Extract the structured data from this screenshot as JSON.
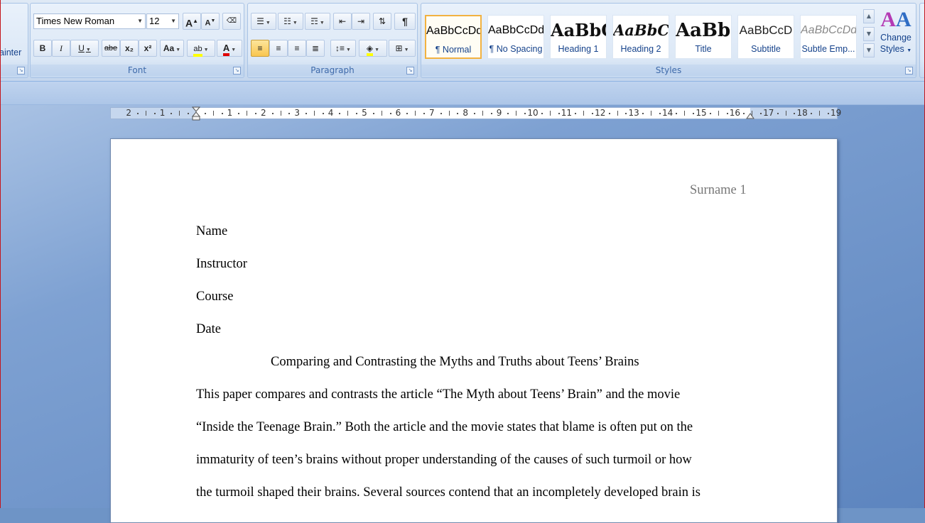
{
  "clipboard": {
    "format_painter_partial": "ainter"
  },
  "font": {
    "group_label": "Font",
    "font_name": "Times New Roman",
    "font_size": "12",
    "bold": "B",
    "italic": "I",
    "underline": "U",
    "strikethrough": "abe",
    "subscript": "x₂",
    "superscript": "x²",
    "change_case": "Aa",
    "grow_font": "A",
    "shrink_font": "A",
    "font_color_letter": "A",
    "highlight_letter": "ab"
  },
  "paragraph": {
    "group_label": "Paragraph",
    "show_marks": "¶"
  },
  "styles": {
    "group_label": "Styles",
    "items": [
      {
        "sample": "AaBbCcDd",
        "name": "¶ Normal",
        "selected": true
      },
      {
        "sample": "AaBbCcDd",
        "name": "¶ No Spacing",
        "selected": false
      },
      {
        "sample": "AaBbC(",
        "name": "Heading 1",
        "selected": false
      },
      {
        "sample": "AaBbCc",
        "name": "Heading 2",
        "selected": false
      },
      {
        "sample": "AaBb(",
        "name": "Title",
        "selected": false
      },
      {
        "sample": "AaBbCcD",
        "name": "Subtitle",
        "selected": false
      },
      {
        "sample": "AaBbCcDd",
        "name": "Subtle Emp...",
        "selected": false
      }
    ],
    "change_styles_line1": "Change",
    "change_styles_line2": "Styles"
  },
  "ruler": {
    "labels_left": [
      "2",
      "1"
    ],
    "labels_right": [
      "1",
      "2",
      "3",
      "4",
      "5",
      "6",
      "7",
      "8",
      "9",
      "10",
      "11",
      "12",
      "13",
      "14",
      "15",
      "16",
      "17",
      "18",
      "19"
    ]
  },
  "document": {
    "header": "Surname 1",
    "lines": [
      "Name",
      "Instructor",
      "Course",
      "Date"
    ],
    "title": "Comparing and Contrasting the Myths and Truths about Teens’ Brains",
    "body": [
      "This paper compares and contrasts the article “The Myth about Teens’ Brain” and the movie",
      "“Inside the Teenage Brain.” Both the article and the movie states that blame is often put on the",
      "immaturity of teen’s brains without proper understanding of the causes of such turmoil or how",
      "the turmoil shaped their brains. Several sources contend that an incompletely developed brain is"
    ]
  }
}
